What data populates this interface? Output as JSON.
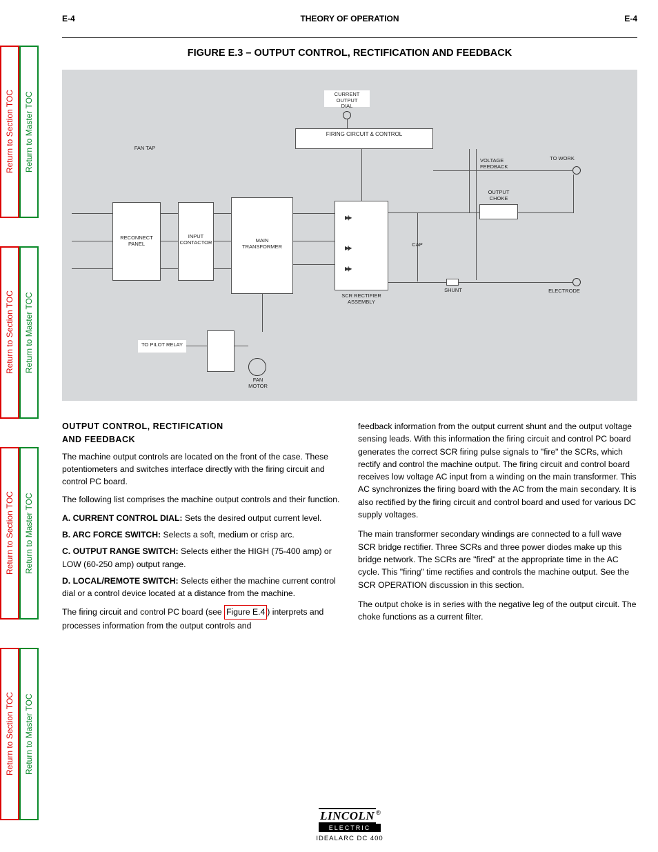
{
  "side_tabs": {
    "section": "Return to Section TOC",
    "master": "Return to Master TOC"
  },
  "header": {
    "left": "E-4",
    "center": "THEORY OF OPERATION",
    "right": "E-4"
  },
  "figure_title": "FIGURE E.3 – OUTPUT CONTROL, RECTIFICATION AND FEEDBACK",
  "diagram": {
    "output_dial": "CURRENT OUTPUT\nDIAL",
    "firing": "FIRING CIRCUIT &\nCONTROL",
    "reconnect": "RECONNECT PANEL",
    "contactor": "INPUT CONTACTOR",
    "fan": "FAN MOTOR",
    "fan_tap": "FAN TAP",
    "pilot": "TO PILOT RELAY",
    "main_txfr": "MAIN\nTRANSFORMER",
    "scr_bridge": "SCR RECTIFIER\nASSEMBLY",
    "output_choke": "OUTPUT\nCHOKE",
    "to_work": "TO WORK",
    "electrode": "ELECTRODE",
    "shunt": "SHUNT",
    "cap": "CAP",
    "voltage_fb": "VOLTAGE\nFEEDBACK"
  },
  "columns": {
    "left": {
      "head": "OUTPUT CONTROL, RECTIFICATION\nAND FEEDBACK",
      "p1": "The machine output controls are located on the front of the case. These potentiometers and switches interface directly with the firing circuit and control PC board.",
      "p2": "The following list comprises the machine output controls and their function.",
      "b1_label": "A. CURRENT CONTROL DIAL:",
      "b1_text": " Sets the desired output current level.",
      "b2_label": "B. ARC FORCE SWITCH:",
      "b2_text": " Selects a soft, medium or crisp arc.",
      "b3_label": "C. OUTPUT RANGE SWITCH:",
      "b3_text": " Selects either the HIGH (75-400 amp) or LOW (60-250 amp) output range.",
      "b4_label": "D. LOCAL/REMOTE SWITCH:",
      "b4_text": " Selects either the machine current control dial or a control device located at a distance from the machine.",
      "p3_pre": "The firing circuit and control PC board (see ",
      "p3_link": "Figure E.4",
      "p3_post": ") interprets and processes information from the output controls and"
    },
    "right": {
      "p1": "feedback information from the output current shunt and the output voltage sensing leads. With this information the firing circuit and control PC board generates the correct SCR firing pulse signals to \"fire\" the SCRs, which rectify and control the machine output. The firing circuit and control board receives low voltage AC input from a winding on the main transformer. This AC synchronizes the firing board with the AC from the main secondary. It is also rectified by the firing circuit and control board and used for various DC supply voltages.",
      "p2": "The main transformer secondary windings are connected to a full wave SCR bridge rectifier. Three SCRs and three power diodes make up this bridge network. The SCRs are \"fired\" at the appropriate time in the AC cycle. This \"firing\" time rectifies and controls the machine output. See the SCR OPERATION discussion in this section.",
      "p3": "The output choke is in series with the negative leg of the output circuit. The choke functions as a current filter."
    }
  },
  "footer": {
    "logo_top": "LINCOLN",
    "logo_bot": "ELECTRIC",
    "model": "IDEALARC DC 400"
  }
}
